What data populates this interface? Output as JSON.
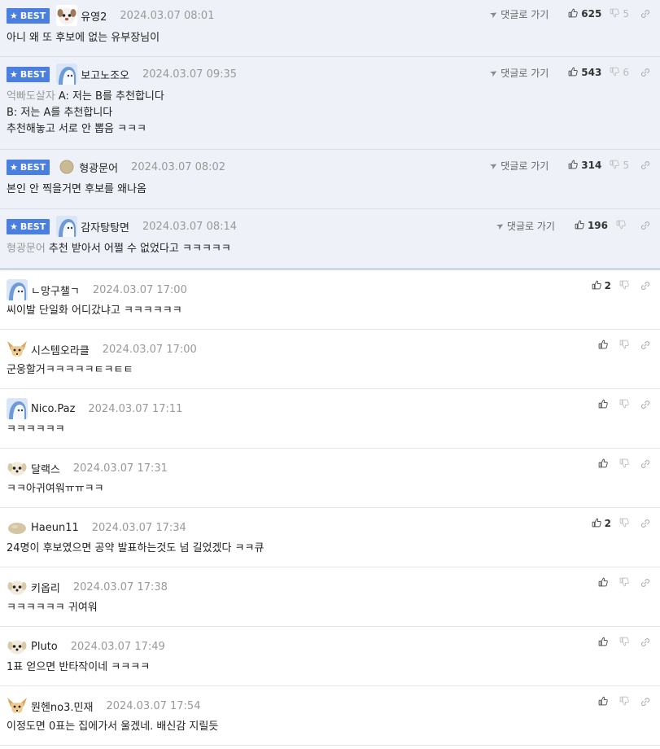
{
  "best_label": "BEST",
  "reply_label": "댓글로 가기",
  "best_comments": [
    {
      "nick": "유영2",
      "date": "2024.03.07 08:01",
      "avatar": "dog-white-avatar-icon",
      "mention": "",
      "lines": [
        "아니 왜 또 후보에 없는 유부장님이"
      ],
      "likes": "625",
      "dislikes": "5"
    },
    {
      "nick": "보고노조오",
      "date": "2024.03.07 09:35",
      "avatar": "blue-character-avatar-icon",
      "mention": "억빠도살자",
      "lines": [
        "A: 저는 B를 추천합니다",
        "B: 저는 A를 추천합니다",
        "추천해놓고 서로 안 뽑음 ㅋㅋㅋ"
      ],
      "likes": "543",
      "dislikes": "6"
    },
    {
      "nick": "형광문어",
      "date": "2024.03.07 08:02",
      "avatar": "beige-circle-avatar-icon",
      "mention": "",
      "lines": [
        "본인 안 찍을거면 후보를 왜나옴"
      ],
      "likes": "314",
      "dislikes": "5"
    },
    {
      "nick": "감자탕탕면",
      "date": "2024.03.07 08:14",
      "avatar": "blue-character-avatar-icon",
      "mention": "형광문어",
      "lines": [
        "추천 받아서 어쩔 수 없었다고 ㅋㅋㅋㅋㅋ"
      ],
      "likes": "196",
      "dislikes": ""
    }
  ],
  "comments": [
    {
      "nick": "ㄴ망구챌ㄱ",
      "date": "2024.03.07 17:00",
      "avatar": "blue-character-avatar-icon",
      "text": "씨이발 단일화 어디갔냐고 ㅋㅋㅋㅋㅋㅋ",
      "likes": "2"
    },
    {
      "nick": "시스템오라클",
      "date": "2024.03.07 17:00",
      "avatar": "fennec-fox-avatar-icon",
      "text": "군웅할거ㅋㅋㅋㅋㅋㅌㅋㅌㅌ",
      "likes": ""
    },
    {
      "nick": "Nico.Paz",
      "date": "2024.03.07 17:11",
      "avatar": "blue-character-avatar-icon",
      "text": "ㅋㅋㅋㅋㅋㅋ",
      "likes": ""
    },
    {
      "nick": "달랙스",
      "date": "2024.03.07 17:31",
      "avatar": "puppy-avatar-icon",
      "text": "ㅋㅋ아귀여워ㅠㅠㅋㅋ",
      "likes": ""
    },
    {
      "nick": "Haeun11",
      "date": "2024.03.07 17:34",
      "avatar": "beige-blob-avatar-icon",
      "text": "24명이 후보였으면 공약 발표하는것도 넘 길었겠다 ㅋㅋ큐",
      "likes": "2"
    },
    {
      "nick": "키옵리",
      "date": "2024.03.07 17:38",
      "avatar": "puppy-avatar-icon",
      "text": "ㅋㅋㅋㅋㅋㅋ 귀여워",
      "likes": ""
    },
    {
      "nick": "Pluto",
      "date": "2024.03.07 17:49",
      "avatar": "puppy-avatar-icon",
      "text": "1표 얻으면 반타작이네 ㅋㅋㅋㅋ",
      "likes": ""
    },
    {
      "nick": "뭔헨no3.민재",
      "date": "2024.03.07 17:54",
      "avatar": "fennec-fox-avatar-icon",
      "text": "이정도면 0표는 집에가서 울겠네. 배신감 지릴듯",
      "likes": ""
    }
  ],
  "colors": {
    "best_badge": "#4a7fe0",
    "best_row_bg": "#eef2f8",
    "date_text": "#999999",
    "mention_text": "#999999"
  }
}
